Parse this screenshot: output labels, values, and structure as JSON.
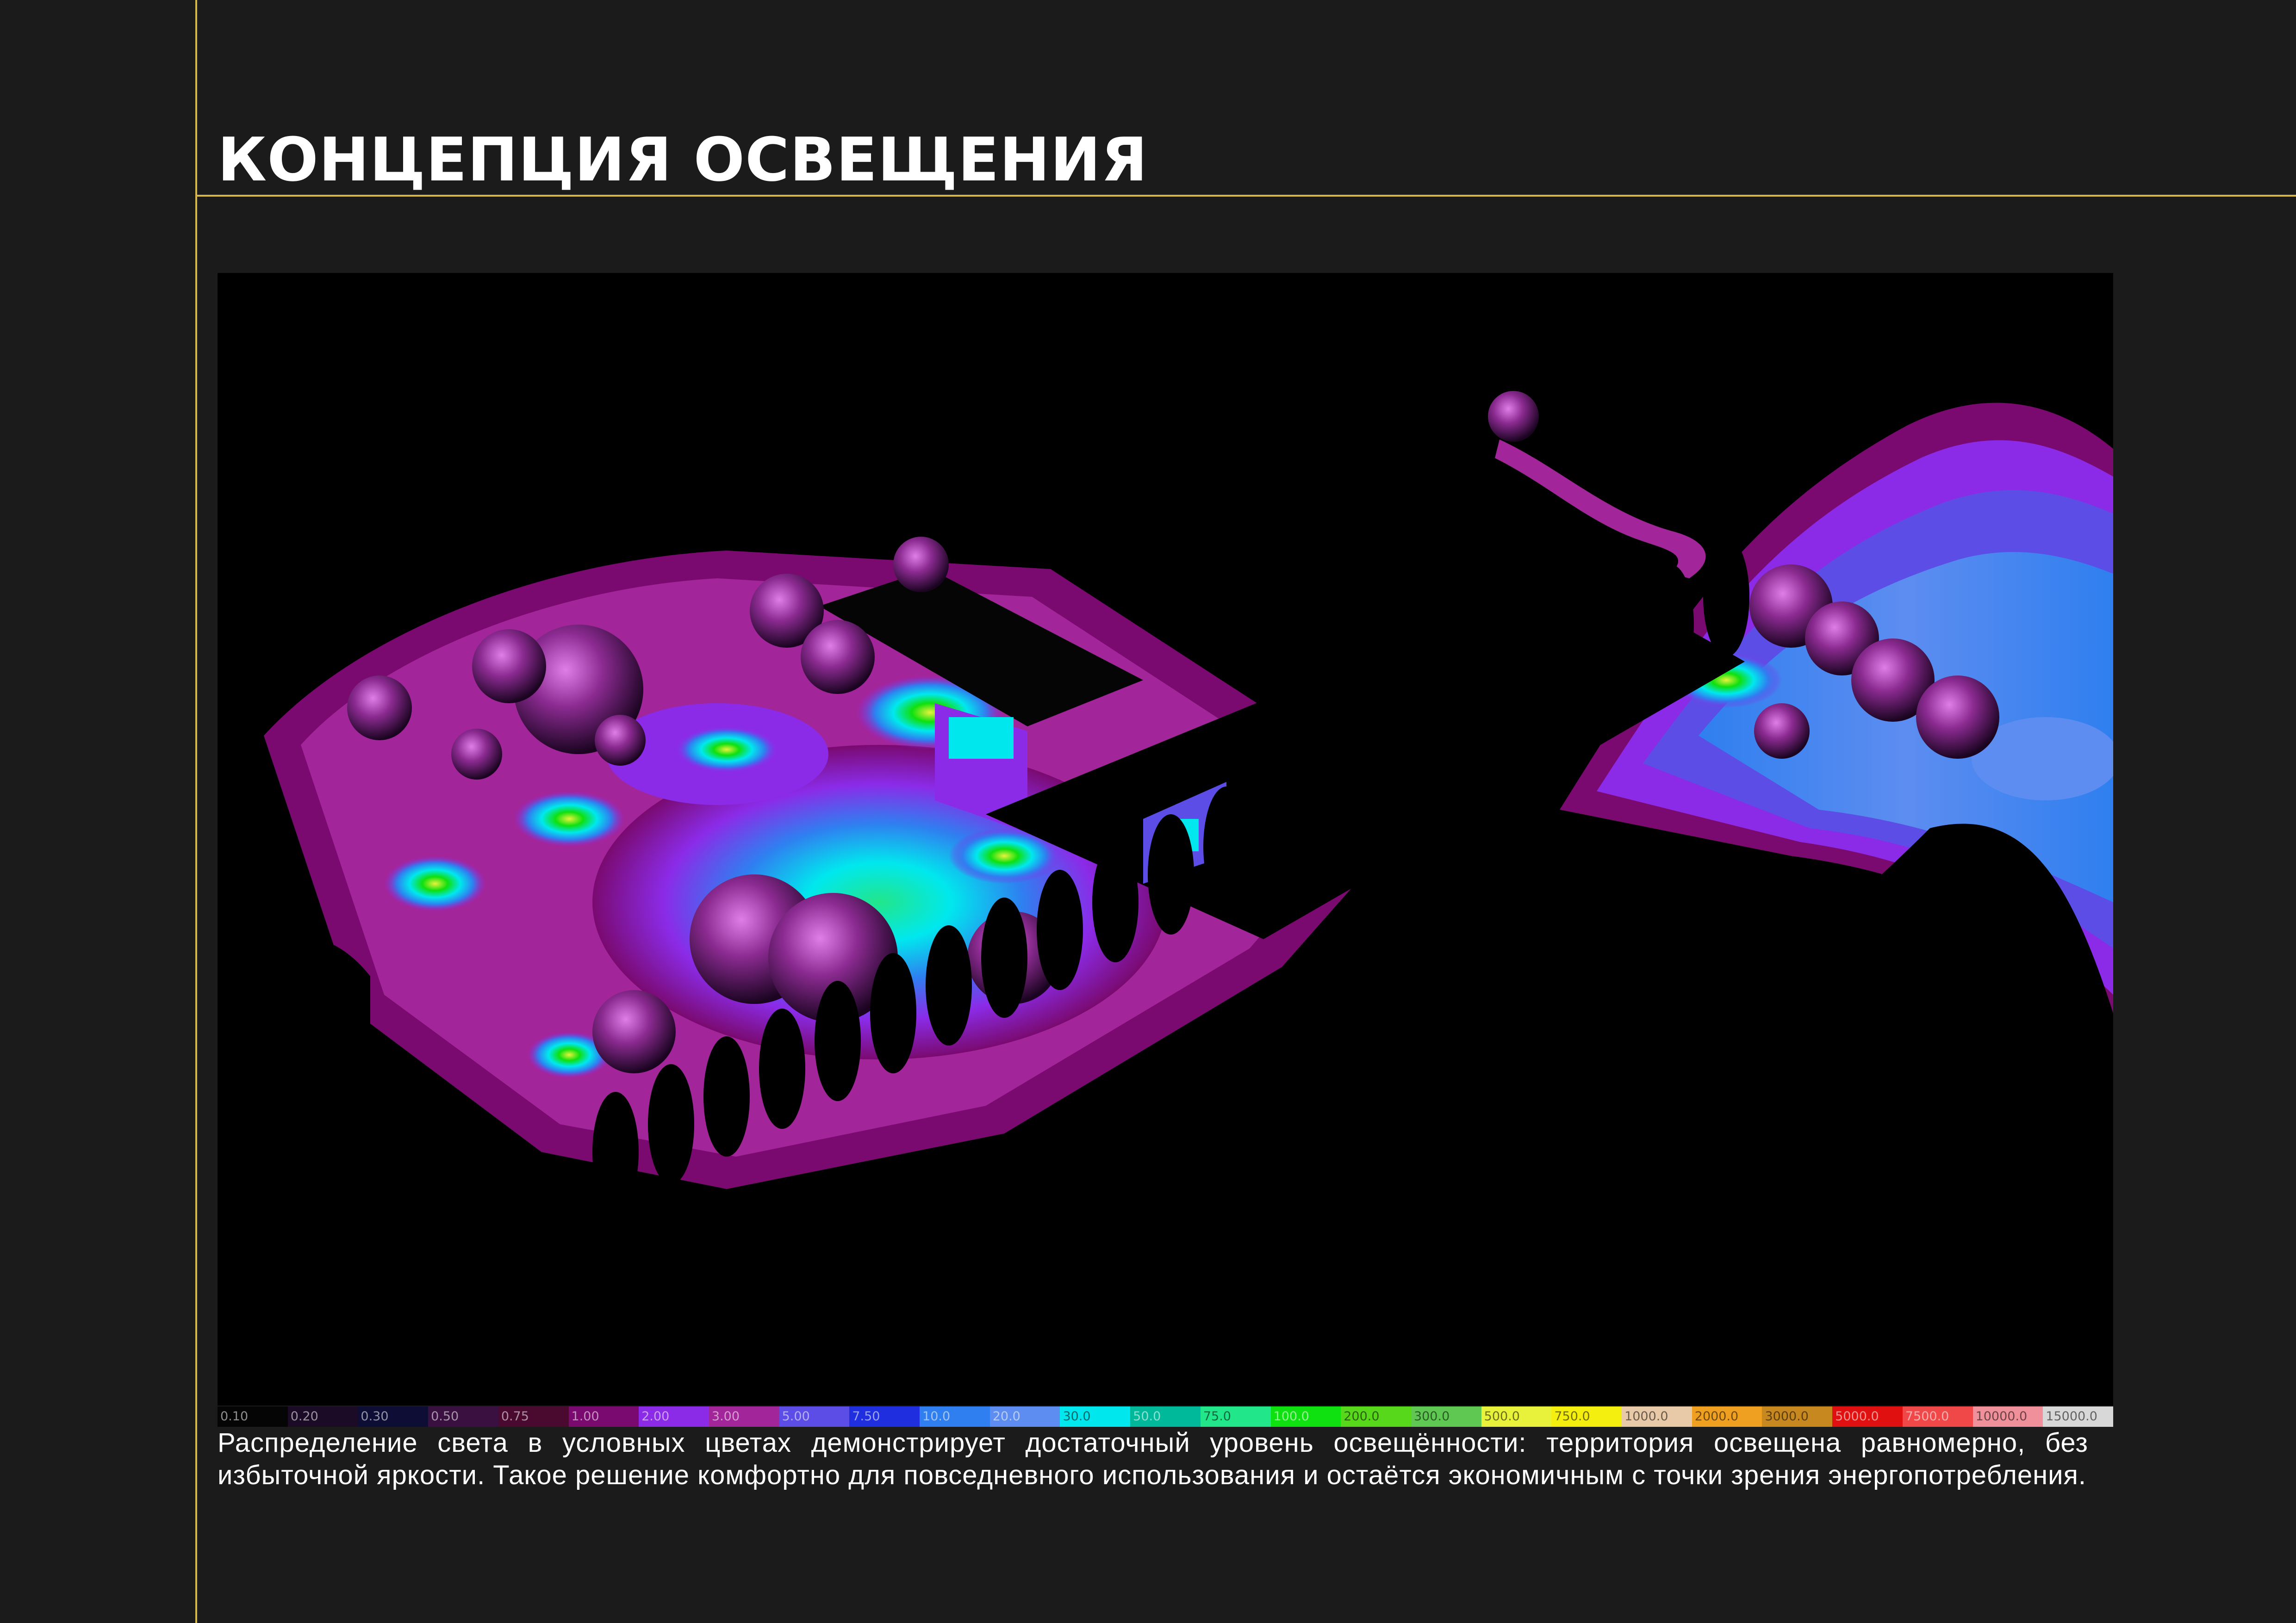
{
  "page": {
    "title": "КОНЦЕПЦИЯ ОСВЕЩЕНИЯ",
    "caption": "Распределение света в условных цветах демонстрирует достаточный уровень освещённости: территория освещена равномерно, без избыточной яркости. Такое решение комфортно для повседневного использования и остаётся экономичным с точки зрения энергопотребления."
  },
  "colors": {
    "background": "#1b1b1b",
    "accent_lines": "#d6b54a",
    "text": "#ffffff"
  },
  "legend": {
    "scale": [
      {
        "label": "0.10",
        "color": "#050505"
      },
      {
        "label": "0.20",
        "color": "#1c0b26"
      },
      {
        "label": "0.30",
        "color": "#0d0d36"
      },
      {
        "label": "0.50",
        "color": "#3a1040"
      },
      {
        "label": "0.75",
        "color": "#4a0a30"
      },
      {
        "label": "1.00",
        "color": "#7a0a70"
      },
      {
        "label": "2.00",
        "color": "#8b2be8"
      },
      {
        "label": "3.00",
        "color": "#a3259a"
      },
      {
        "label": "5.00",
        "color": "#5c4de6"
      },
      {
        "label": "7.50",
        "color": "#1f2fe0"
      },
      {
        "label": "10.0",
        "color": "#2f7ff0"
      },
      {
        "label": "20.0",
        "color": "#5d8df0"
      },
      {
        "label": "30.0",
        "color": "#00e8ee"
      },
      {
        "label": "50.0",
        "color": "#00b89a"
      },
      {
        "label": "75.0",
        "color": "#22e68a"
      },
      {
        "label": "100.0",
        "color": "#0fe00f"
      },
      {
        "label": "200.0",
        "color": "#58d81a"
      },
      {
        "label": "300.0",
        "color": "#5fc853"
      },
      {
        "label": "500.0",
        "color": "#e8f23b"
      },
      {
        "label": "750.0",
        "color": "#f5ef10"
      },
      {
        "label": "1000.0",
        "color": "#e8c9a8"
      },
      {
        "label": "2000.0",
        "color": "#f0a020"
      },
      {
        "label": "3000.0",
        "color": "#c88820"
      },
      {
        "label": "5000.0",
        "color": "#e01010"
      },
      {
        "label": "7500.0",
        "color": "#f04848"
      },
      {
        "label": "10000.0",
        "color": "#f0909a"
      },
      {
        "label": "15000.0",
        "color": "#d8d8d8"
      }
    ]
  }
}
